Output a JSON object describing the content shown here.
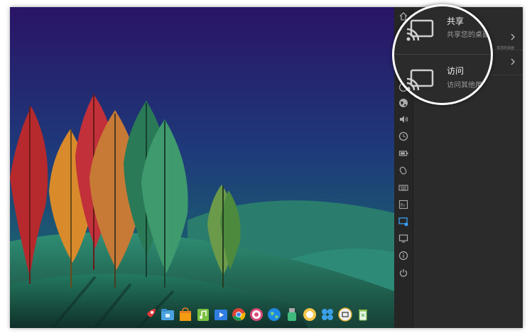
{
  "control_center": {
    "share": {
      "title": "共享",
      "subtitle": "共享您的桌面",
      "tiny_text": "享您的桌面"
    },
    "visit": {
      "title": "访问",
      "subtitle": "访问其他用户"
    },
    "magnifier": {
      "share_title": "共享",
      "share_subtitle": "共享您的桌面",
      "visit_title": "访问",
      "visit_subtitle": "访问其他用户"
    },
    "side_icons": [
      "home-icon",
      "remote-icon",
      "network-icon",
      "sound-icon",
      "clock-icon",
      "battery-icon",
      "mouse-icon",
      "keyboard-icon",
      "fn-key-icon",
      "display-settings-icon",
      "monitor-icon",
      "info-icon",
      "power-icon"
    ]
  },
  "dock": {
    "items": [
      "launcher-rocket-icon",
      "file-manager-icon",
      "app-store-icon",
      "music-player-icon",
      "video-player-icon",
      "chrome-browser-icon",
      "settings-gear-icon",
      "browser-globe-icon",
      "usb-drive-icon",
      "deepin-icon",
      "apps-grid-icon",
      "screenshot-icon",
      "trash-icon"
    ]
  },
  "colors": {
    "panel_bg": "#2b2b2b",
    "sky_top": "#2a1466",
    "sky_bottom": "#1c5a70",
    "hill_green": "#2f7d63"
  }
}
